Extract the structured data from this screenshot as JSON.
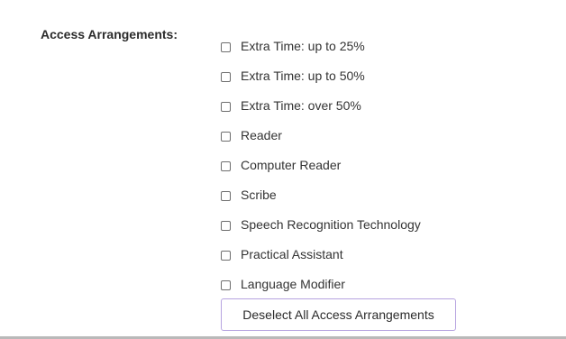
{
  "section": {
    "label": "Access Arrangements:"
  },
  "options": [
    {
      "label": "Extra Time: up to 25%",
      "checked": false
    },
    {
      "label": "Extra Time: up to 50%",
      "checked": false
    },
    {
      "label": "Extra Time: over 50%",
      "checked": false
    },
    {
      "label": "Reader",
      "checked": false
    },
    {
      "label": "Computer Reader",
      "checked": false
    },
    {
      "label": "Scribe",
      "checked": false
    },
    {
      "label": "Speech Recognition Technology",
      "checked": false
    },
    {
      "label": "Practical Assistant",
      "checked": false
    },
    {
      "label": "Language Modifier",
      "checked": false
    }
  ],
  "deselect_button": {
    "label": "Deselect All Access Arrangements"
  },
  "colors": {
    "button_border": "#b6a3e0",
    "text": "#333333",
    "checkbox_border": "#6e6e6e"
  }
}
